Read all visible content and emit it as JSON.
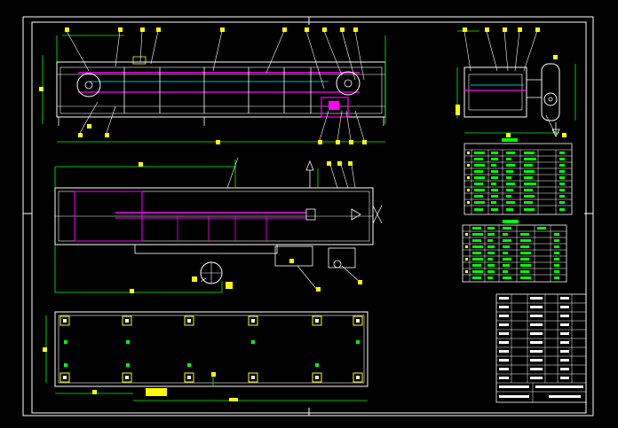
{
  "colors": {
    "background": "#000000",
    "outline": "#ffffff",
    "dimension": "#00ff00",
    "annotation": "#ffff00",
    "highlight": "#ff00ff",
    "table_text": "#00ff00"
  },
  "drawing_views": [
    "front-elevation",
    "side-elevation",
    "top-plan",
    "base-foundation-plan"
  ],
  "tables": {
    "parts_list_upper": {
      "rows": 11,
      "columns": 7
    },
    "parts_list_lower": {
      "rows": 9,
      "columns": 7
    },
    "title_block": {
      "rows": 12
    }
  },
  "icons": [
    "section-arrow-icon",
    "view-direction-arrow-icon",
    "north-arrow-icon"
  ]
}
